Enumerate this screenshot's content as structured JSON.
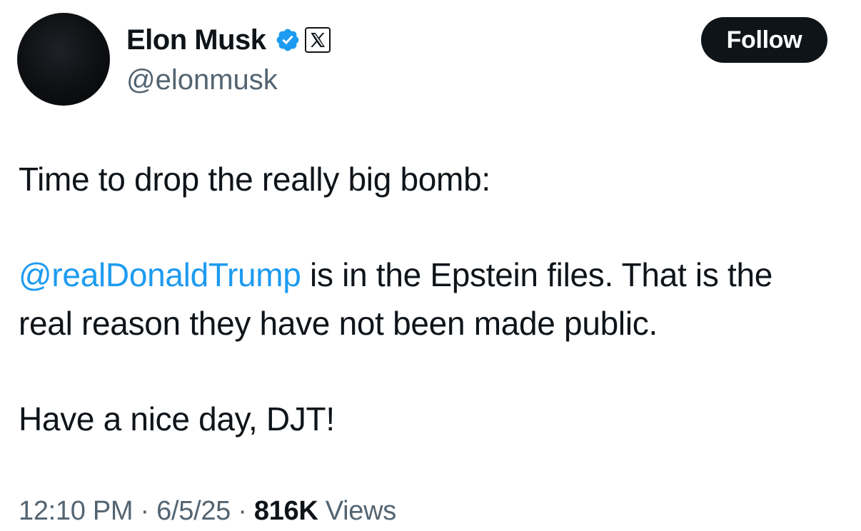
{
  "author": {
    "display_name": "Elon Musk",
    "handle": "@elonmusk",
    "verified_badge_icon": "verified-checkmark-icon",
    "affiliate_badge_icon": "x-logo-icon"
  },
  "follow_button": {
    "label": "Follow"
  },
  "tweet": {
    "line1": "Time to drop the really big bomb:",
    "mention": "@realDonaldTrump",
    "line2_rest": " is in the Epstein files. That is the",
    "line3": "real reason they have not been made public.",
    "line4": "Have a nice day, DJT!"
  },
  "meta": {
    "time": "12:10 PM",
    "separator": " · ",
    "date": "6/5/25",
    "views_count": "816K",
    "views_label": " Views"
  },
  "colors": {
    "text": "#0f1419",
    "secondary": "#536471",
    "link": "#1d9bf0",
    "verified": "#1d9bf0"
  }
}
